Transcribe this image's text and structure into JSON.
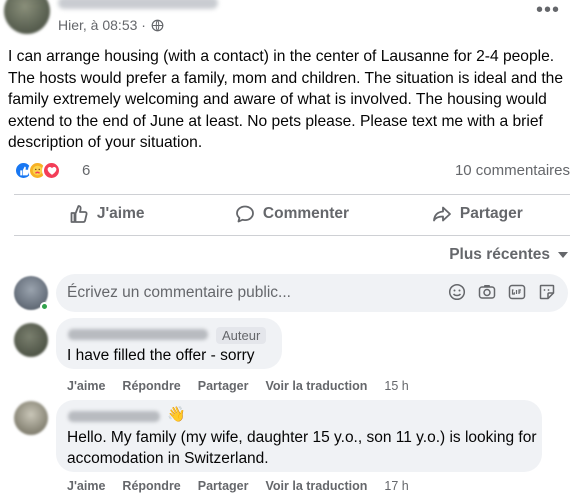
{
  "post": {
    "timestamp": "Hier, à 08:53 ·",
    "privacy_icon": "globe-icon",
    "more_label": "•••",
    "text": "I can arrange housing (with a contact) in the center of Lausanne for 2-4 people. The hosts would prefer a family, mom and children. The situation is ideal and the family extremely welcoming and aware of what is involved. The housing would extend to the end of June at least. No pets please. Please text me with a brief description of your situation.",
    "reaction_count": "6",
    "comment_count": "10 commentaires"
  },
  "actions": {
    "like": "J'aime",
    "comment": "Commenter",
    "share": "Partager"
  },
  "sort_label": "Plus récentes",
  "composer": {
    "placeholder": "Écrivez un commentaire public..."
  },
  "comments": [
    {
      "badge": "Auteur",
      "text": "I have filled the offer - sorry",
      "like": "J'aime",
      "reply": "Répondre",
      "share": "Partager",
      "translate": "Voir la traduction",
      "time": "15 h"
    },
    {
      "emoji": "👋",
      "text": "Hello. My family (my wife, daughter 15 y.o., son 11 y.o.) is looking for accomodation in Switzerland.",
      "like": "J'aime",
      "reply": "Répondre",
      "share": "Partager",
      "translate": "Voir la traduction",
      "time": "17 h"
    }
  ],
  "colors": {
    "accent": "#1877f2",
    "secondary_text": "#65676b",
    "bubble": "#f0f2f5"
  }
}
